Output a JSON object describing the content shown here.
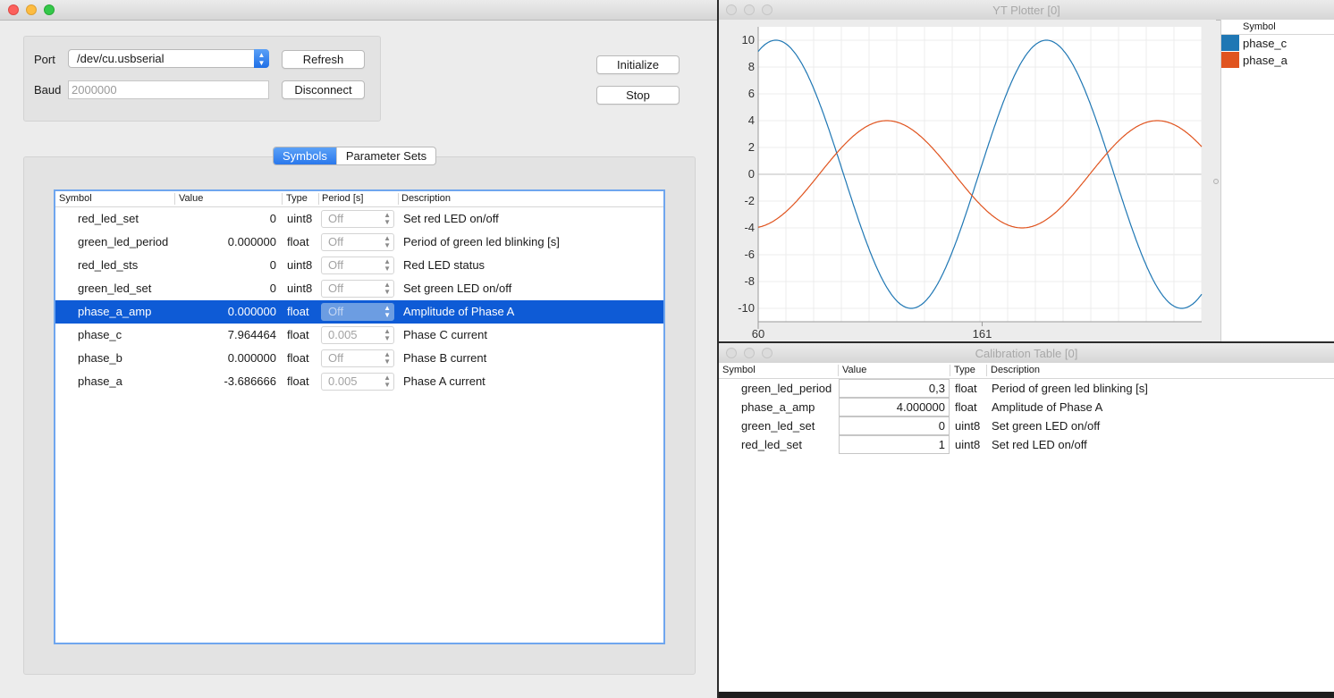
{
  "main_window": {
    "port_label": "Port",
    "port_value": "/dev/cu.usbserial",
    "baud_label": "Baud",
    "baud_placeholder": "2000000",
    "refresh_button": "Refresh",
    "disconnect_button": "Disconnect",
    "initialize_button": "Initialize",
    "stop_button": "Stop",
    "tabs": [
      "Symbols",
      "Parameter Sets"
    ],
    "active_tab": "Symbols",
    "table": {
      "columns": [
        "Symbol",
        "Value",
        "Type",
        "Period [s]",
        "Description"
      ],
      "rows": [
        {
          "symbol": "red_led_set",
          "value": "0",
          "type": "uint8",
          "period": "Off",
          "description": "Set red LED on/off"
        },
        {
          "symbol": "green_led_period",
          "value": "0.000000",
          "type": "float",
          "period": "Off",
          "description": "Period of green led blinking [s]"
        },
        {
          "symbol": "red_led_sts",
          "value": "0",
          "type": "uint8",
          "period": "Off",
          "description": "Red LED status"
        },
        {
          "symbol": "green_led_set",
          "value": "0",
          "type": "uint8",
          "period": "Off",
          "description": "Set green LED on/off"
        },
        {
          "symbol": "phase_a_amp",
          "value": "0.000000",
          "type": "float",
          "period": "Off",
          "description": "Amplitude of Phase A",
          "selected": true
        },
        {
          "symbol": "phase_c",
          "value": "7.964464",
          "type": "float",
          "period": "0.005",
          "description": "Phase C current"
        },
        {
          "symbol": "phase_b",
          "value": "0.000000",
          "type": "float",
          "period": "Off",
          "description": "Phase B current"
        },
        {
          "symbol": "phase_a",
          "value": "-3.686666",
          "type": "float",
          "period": "0.005",
          "description": "Phase A current"
        }
      ]
    }
  },
  "plotter": {
    "title": "YT Plotter [0]",
    "legend_header": "Symbol",
    "legend": [
      {
        "name": "phase_c",
        "color": "#1f77b4"
      },
      {
        "name": "phase_a",
        "color": "#e0541f"
      }
    ],
    "y_ticks": [
      "10",
      "8",
      "6",
      "4",
      "2",
      "0",
      "-2",
      "-4",
      "-6",
      "-8",
      "-10"
    ],
    "x_ticks": [
      "60",
      "161"
    ]
  },
  "chart_data": {
    "type": "line",
    "x_range": [
      60,
      260
    ],
    "ylim": [
      -11,
      11
    ],
    "grid": true,
    "series": [
      {
        "name": "phase_c",
        "color": "#1f77b4",
        "amplitude": 10,
        "x_at_first_peak": 68,
        "period": 122
      },
      {
        "name": "phase_a",
        "color": "#e0541f",
        "amplitude": 4,
        "x_at_first_peak": 118,
        "period": 122
      }
    ]
  },
  "calibration": {
    "title": "Calibration Table [0]",
    "columns": [
      "Symbol",
      "Value",
      "Type",
      "Description"
    ],
    "rows": [
      {
        "symbol": "green_led_period",
        "value": "0,3",
        "type": "float",
        "description": "Period of green led blinking [s]"
      },
      {
        "symbol": "phase_a_amp",
        "value": "4.000000",
        "type": "float",
        "description": "Amplitude of Phase A"
      },
      {
        "symbol": "green_led_set",
        "value": "0",
        "type": "uint8",
        "description": "Set green LED on/off"
      },
      {
        "symbol": "red_led_set",
        "value": "1",
        "type": "uint8",
        "description": "Set red LED on/off"
      }
    ]
  }
}
